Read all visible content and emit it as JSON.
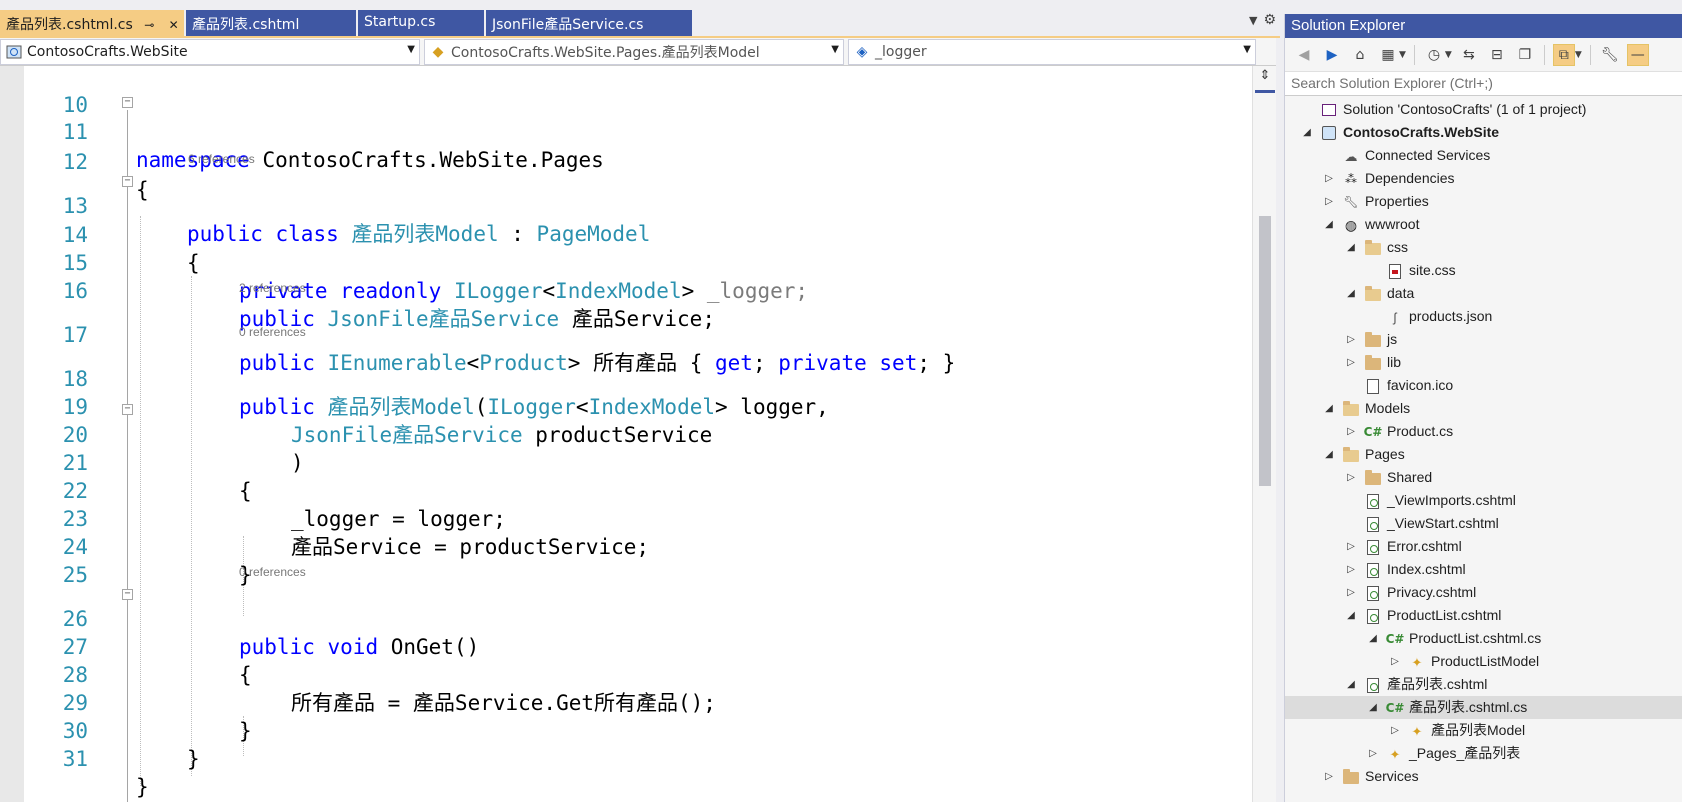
{
  "tabs": [
    {
      "label": "產品列表.cshtml.cs",
      "active": true,
      "pin": "⊸",
      "close": "✕"
    },
    {
      "label": "產品列表.cshtml",
      "active": false
    },
    {
      "label": "Startup.cs",
      "active": false
    },
    {
      "label": "JsonFile產品Service.cs",
      "active": false
    }
  ],
  "nav": {
    "project": "ContosoCrafts.WebSite",
    "type": "ContosoCrafts.WebSite.Pages.產品列表Model",
    "member": "_logger"
  },
  "code": {
    "lines": [
      {
        "n": "10"
      },
      {
        "n": "11"
      },
      {
        "n": "12"
      },
      {
        "n": "13"
      },
      {
        "n": "14"
      },
      {
        "n": "15"
      },
      {
        "n": "16"
      },
      {
        "n": "17"
      },
      {
        "n": "18"
      },
      {
        "n": "19"
      },
      {
        "n": "20"
      },
      {
        "n": "21"
      },
      {
        "n": "22"
      },
      {
        "n": "23"
      },
      {
        "n": "24"
      },
      {
        "n": "25"
      },
      {
        "n": "26"
      },
      {
        "n": "27"
      },
      {
        "n": "28"
      },
      {
        "n": "29"
      },
      {
        "n": "30"
      },
      {
        "n": "31"
      }
    ],
    "refs": {
      "class_refs": "6 references",
      "prop_refs": "2 references",
      "ctor_refs": "0 references",
      "onget_refs": "0 references"
    },
    "t": {
      "namespace_kw": "namespace",
      "namespace_name": " ContosoCrafts.WebSite.Pages",
      "open_brace": "{",
      "close_brace": "}",
      "public": "public",
      "class": "class",
      "class_name": "產品列表Model",
      "colon": " : ",
      "base": "PageModel",
      "private": "private",
      "readonly": "readonly",
      "ilogger": "ILogger",
      "lt": "<",
      "gt": ">",
      "indexmodel": "IndexModel",
      "logger_field": " _logger;",
      "service_type": "JsonFile產品Service",
      "service_field": " 產品Service;",
      "ienumerable": "IEnumerable",
      "product": "Product",
      "prop_name": " 所有產品 { ",
      "get": "get",
      "semi_sp": "; ",
      "set": "set",
      "prop_end": "; }",
      "ctor_open": "(",
      "logger_param": " logger,",
      "service_param": " productService",
      "close_paren": ")",
      "assign_logger": "_logger = logger;",
      "assign_service": "產品Service = productService;",
      "void": "void",
      "onget": " OnGet()",
      "get_all": "所有產品 = 產品Service.Get所有產品();"
    }
  },
  "solution_explorer": {
    "title": "Solution Explorer",
    "search_placeholder": "Search Solution Explorer (Ctrl+;)",
    "items": [
      {
        "label": "Solution 'ContosoCrafts' (1 of 1 project)",
        "icon": "solution-icon",
        "level": 0,
        "arrow": ""
      },
      {
        "label": "ContosoCrafts.WebSite",
        "icon": "web-project-icon",
        "level": 0,
        "arrow": "◢",
        "bold": true
      },
      {
        "label": "Connected Services",
        "icon": "connected-services-icon",
        "level": 1,
        "arrow": ""
      },
      {
        "label": "Dependencies",
        "icon": "dependencies-icon",
        "level": 1,
        "arrow": "▷"
      },
      {
        "label": "Properties",
        "icon": "properties-icon",
        "level": 1,
        "arrow": "▷"
      },
      {
        "label": "wwwroot",
        "icon": "globe-icon",
        "level": 1,
        "arrow": "◢"
      },
      {
        "label": "css",
        "icon": "folder-open-icon",
        "level": 2,
        "arrow": "◢"
      },
      {
        "label": "site.css",
        "icon": "css-file-icon",
        "level": 3,
        "arrow": ""
      },
      {
        "label": "data",
        "icon": "folder-open-icon",
        "level": 2,
        "arrow": "◢"
      },
      {
        "label": "products.json",
        "icon": "json-file-icon",
        "level": 3,
        "arrow": ""
      },
      {
        "label": "js",
        "icon": "folder-icon",
        "level": 2,
        "arrow": "▷"
      },
      {
        "label": "lib",
        "icon": "folder-icon",
        "level": 2,
        "arrow": "▷"
      },
      {
        "label": "favicon.ico",
        "icon": "file-icon",
        "level": 2,
        "arrow": ""
      },
      {
        "label": "Models",
        "icon": "folder-open-icon",
        "level": 1,
        "arrow": "◢"
      },
      {
        "label": "Product.cs",
        "icon": "csharp-file-icon",
        "level": 2,
        "arrow": "▷"
      },
      {
        "label": "Pages",
        "icon": "folder-open-icon",
        "level": 1,
        "arrow": "◢"
      },
      {
        "label": "Shared",
        "icon": "folder-icon",
        "level": 2,
        "arrow": "▷"
      },
      {
        "label": "_ViewImports.cshtml",
        "icon": "razor-file-icon",
        "level": 2,
        "arrow": ""
      },
      {
        "label": "_ViewStart.cshtml",
        "icon": "razor-file-icon",
        "level": 2,
        "arrow": ""
      },
      {
        "label": "Error.cshtml",
        "icon": "razor-file-icon",
        "level": 2,
        "arrow": "▷"
      },
      {
        "label": "Index.cshtml",
        "icon": "razor-file-icon",
        "level": 2,
        "arrow": "▷"
      },
      {
        "label": "Privacy.cshtml",
        "icon": "razor-file-icon",
        "level": 2,
        "arrow": "▷"
      },
      {
        "label": "ProductList.cshtml",
        "icon": "razor-file-icon",
        "level": 2,
        "arrow": "◢"
      },
      {
        "label": "ProductList.cshtml.cs",
        "icon": "csharp-file-icon",
        "level": 3,
        "arrow": "◢"
      },
      {
        "label": "ProductListModel",
        "icon": "class-icon",
        "level": 4,
        "arrow": "▷"
      },
      {
        "label": "產品列表.cshtml",
        "icon": "razor-file-icon",
        "level": 2,
        "arrow": "◢"
      },
      {
        "label": "產品列表.cshtml.cs",
        "icon": "csharp-file-icon",
        "level": 3,
        "arrow": "◢",
        "selected": true
      },
      {
        "label": "產品列表Model",
        "icon": "class-icon",
        "level": 4,
        "arrow": "▷"
      },
      {
        "label": "_Pages_產品列表",
        "icon": "class-icon",
        "level": 3,
        "arrow": "▷"
      },
      {
        "label": "Services",
        "icon": "folder-icon",
        "level": 1,
        "arrow": "▷"
      }
    ]
  },
  "colors": {
    "tab_active": "#f5cc84",
    "tab_inactive": "#3f57a3",
    "keyword": "#0000ff",
    "type": "#2b91af",
    "line_number": "#2b91af"
  }
}
